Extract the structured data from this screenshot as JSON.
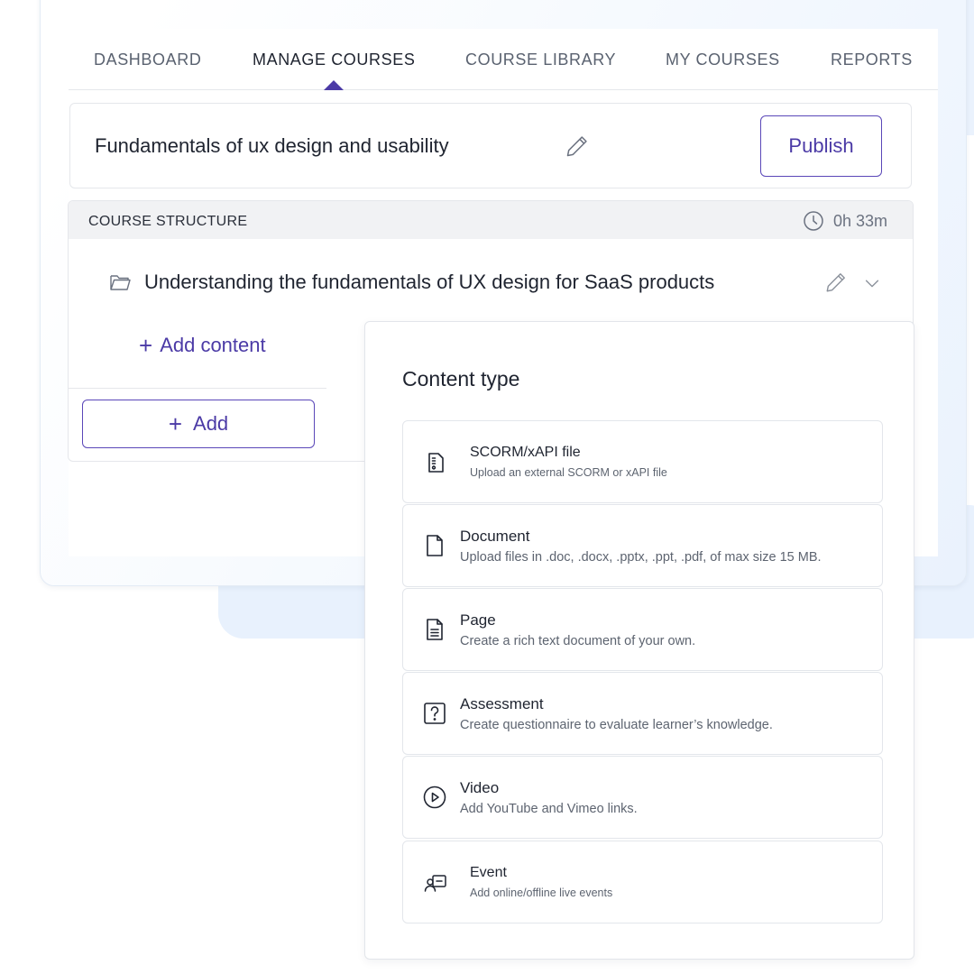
{
  "nav": {
    "tabs": [
      {
        "label": "DASHBOARD"
      },
      {
        "label": "MANAGE COURSES"
      },
      {
        "label": "COURSE LIBRARY"
      },
      {
        "label": "MY COURSES"
      },
      {
        "label": "REPORTS"
      }
    ],
    "active_tab": "MANAGE COURSES"
  },
  "course": {
    "title": "Fundamentals of ux design and usability",
    "publish_label": "Publish"
  },
  "structure": {
    "header_label": "COURSE STRUCTURE",
    "duration": "0h 33m",
    "section_title": "Understanding the fundamentals of UX design for SaaS products",
    "add_content_label": "Add content",
    "add_label": "Add"
  },
  "content_type": {
    "title": "Content type",
    "options": [
      {
        "label": "SCORM/xAPI file",
        "description": "Upload an external SCORM or xAPI file",
        "icon": "scorm-file-icon"
      },
      {
        "label": "Document",
        "description": "Upload files in .doc, .docx, .pptx, .ppt, .pdf, of max size 15 MB.",
        "icon": "document-icon"
      },
      {
        "label": "Page",
        "description": "Create a rich text document of your own.",
        "icon": "page-icon"
      },
      {
        "label": "Assessment",
        "description": "Create questionnaire to evaluate learner’s knowledge.",
        "icon": "question-icon"
      },
      {
        "label": "Video",
        "description": "Add YouTube and Vimeo links.",
        "icon": "play-icon"
      },
      {
        "label": "Event",
        "description": "Add online/offline live events",
        "icon": "event-icon"
      }
    ]
  },
  "colors": {
    "accent": "#4b3aa6",
    "border": "#e5e7eb",
    "header_bg": "#f1f2f4",
    "background_blue": "#e8f1fd"
  }
}
